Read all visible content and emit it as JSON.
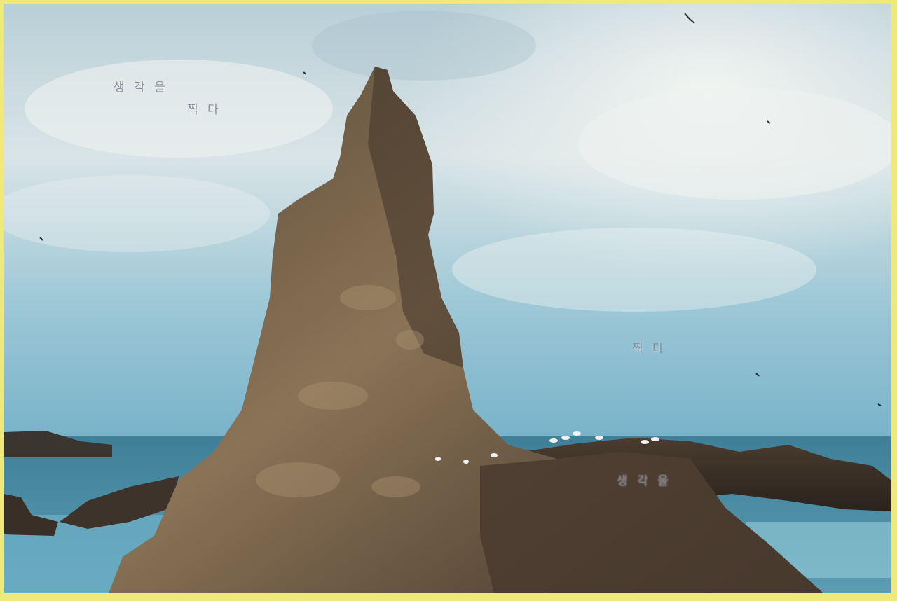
{
  "watermarks": [
    {
      "text": "생 각 을"
    },
    {
      "text": "찍 다"
    },
    {
      "text": "찍 다"
    },
    {
      "text": "생 각 을"
    }
  ],
  "colors": {
    "border": "#efe87a",
    "sky_top": "#c9d9df",
    "sky_horizon": "#7fb6cc",
    "sea": "#4f8fa6",
    "rock": "#6b5a43"
  }
}
